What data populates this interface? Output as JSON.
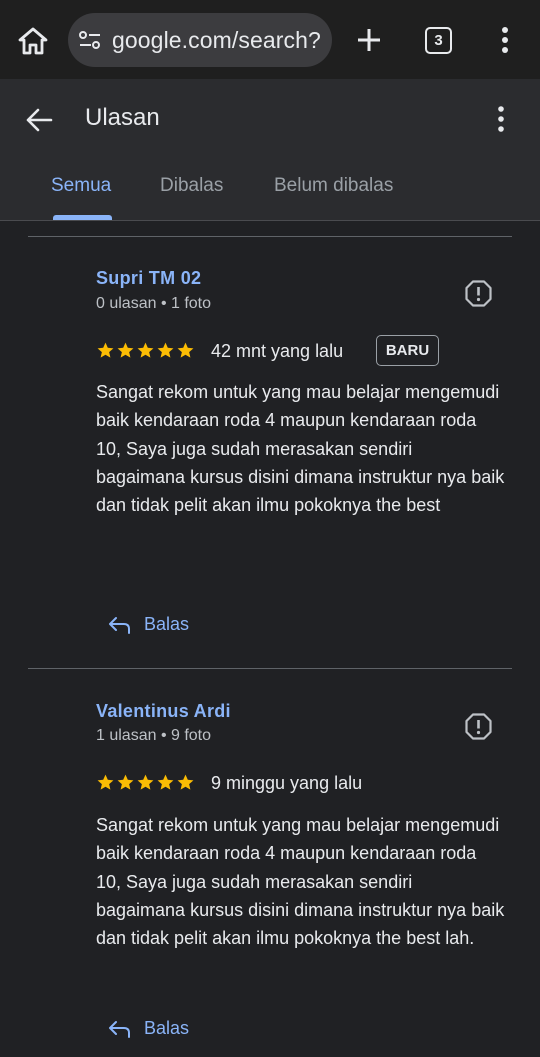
{
  "browser": {
    "url": "google.com/search?",
    "tab_count": "3",
    "icons": [
      "home-icon",
      "site-settings-icon",
      "plus-icon",
      "tab-switcher-icon",
      "more-vert-icon"
    ]
  },
  "header": {
    "title": "Ulasan",
    "tabs": [
      {
        "label": "Semua",
        "active": true
      },
      {
        "label": "Dibalas",
        "active": false
      },
      {
        "label": "Belum dibalas",
        "active": false
      }
    ]
  },
  "colors": {
    "background": "#202124",
    "accent": "#8ab4f8",
    "star": "#fbbc04"
  },
  "reviews": [
    {
      "name": "Supri TM 02",
      "meta": "0 ulasan • 1 foto",
      "rating": 5,
      "time": "42 mnt yang lalu",
      "badge": "BARU",
      "text": "Sangat rekom untuk yang mau belajar mengemudi baik kendaraan roda 4 maupun kendaraan roda 10, Saya juga sudah merasakan sendiri bagaimana kursus disini dimana instruktur nya baik dan tidak pelit akan ilmu pokoknya the best",
      "reply_label": "Balas"
    },
    {
      "name": "Valentinus Ardi",
      "meta": "1 ulasan • 9 foto",
      "rating": 5,
      "time": "9 minggu yang lalu",
      "text": "Sangat rekom untuk yang mau belajar mengemudi baik kendaraan roda 4 maupun kendaraan roda 10, Saya juga sudah merasakan sendiri bagaimana kursus disini dimana instruktur nya baik dan tidak pelit akan ilmu pokoknya the best lah.",
      "reply_label": "Balas"
    }
  ]
}
